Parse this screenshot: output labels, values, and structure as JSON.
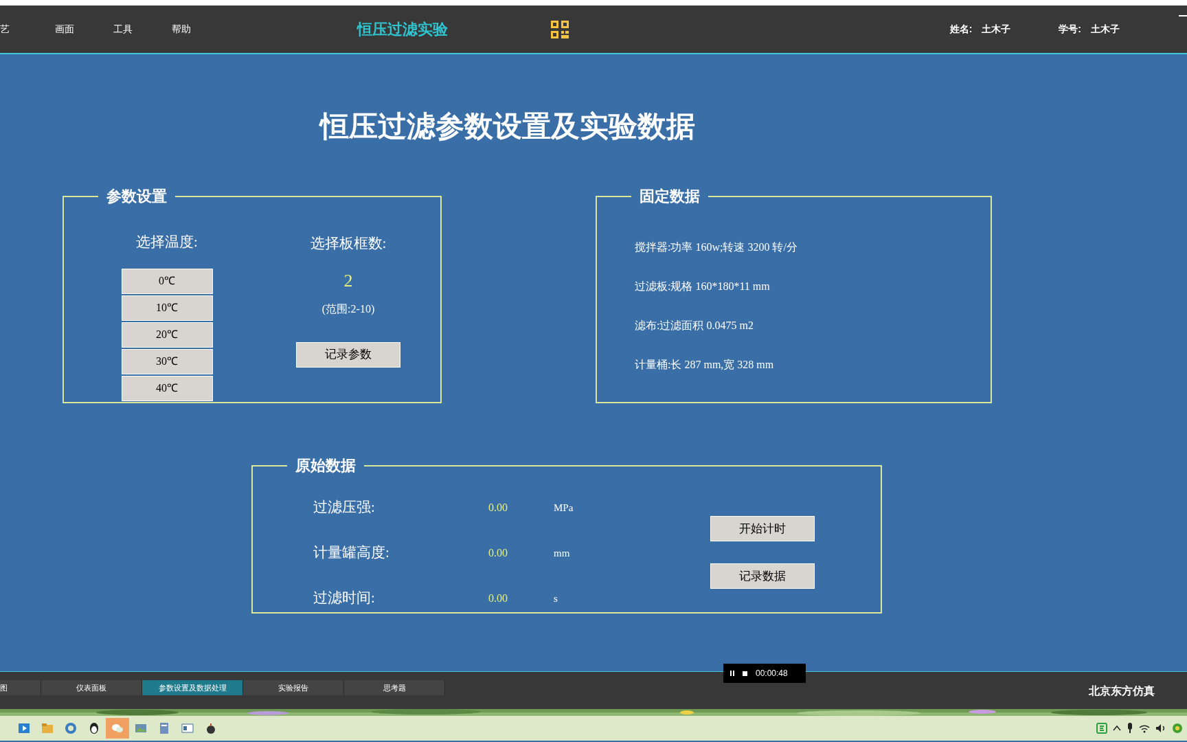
{
  "menu": [
    {
      "label": "艺"
    },
    {
      "label": "画面"
    },
    {
      "label": "工具"
    },
    {
      "label": "帮助"
    }
  ],
  "app_title": "恒压过滤实验",
  "user": {
    "name_label": "姓名:",
    "name": "土木子",
    "id_label": "学号:",
    "id": "土木子"
  },
  "page_title": "恒压过滤参数设置及实验数据",
  "params": {
    "legend": "参数设置",
    "temp_label": "选择温度:",
    "temps": [
      "0℃",
      "10℃",
      "20℃",
      "30℃",
      "40℃"
    ],
    "plates_label": "选择板框数:",
    "plates_value": "2",
    "range": "(范围:2-10)",
    "record_button": "记录参数"
  },
  "fixed": {
    "legend": "固定数据",
    "lines": [
      "搅拌器:功率 160w;转速 3200 转/分",
      "过滤板:规格 160*180*11 mm",
      "滤布:过滤面积 0.0475 m2",
      "计量桶:长 287 mm,宽 328 mm"
    ]
  },
  "raw": {
    "legend": "原始数据",
    "rows": [
      {
        "label": "过滤压强:",
        "value": "0.00",
        "unit": "MPa"
      },
      {
        "label": "计量罐高度:",
        "value": "0.00",
        "unit": "mm"
      },
      {
        "label": "过滤时间:",
        "value": "0.00",
        "unit": "s"
      }
    ],
    "buttons": [
      "开始计时",
      "记录数据"
    ]
  },
  "player": {
    "time": "00:00:48"
  },
  "tabs": [
    {
      "label": "图",
      "selected": false
    },
    {
      "label": "仪表面板",
      "selected": false
    },
    {
      "label": "参数设置及数据处理",
      "selected": true
    },
    {
      "label": "实验报告",
      "selected": false
    },
    {
      "label": "思考题",
      "selected": false
    }
  ],
  "brand": "北京东方仿真"
}
